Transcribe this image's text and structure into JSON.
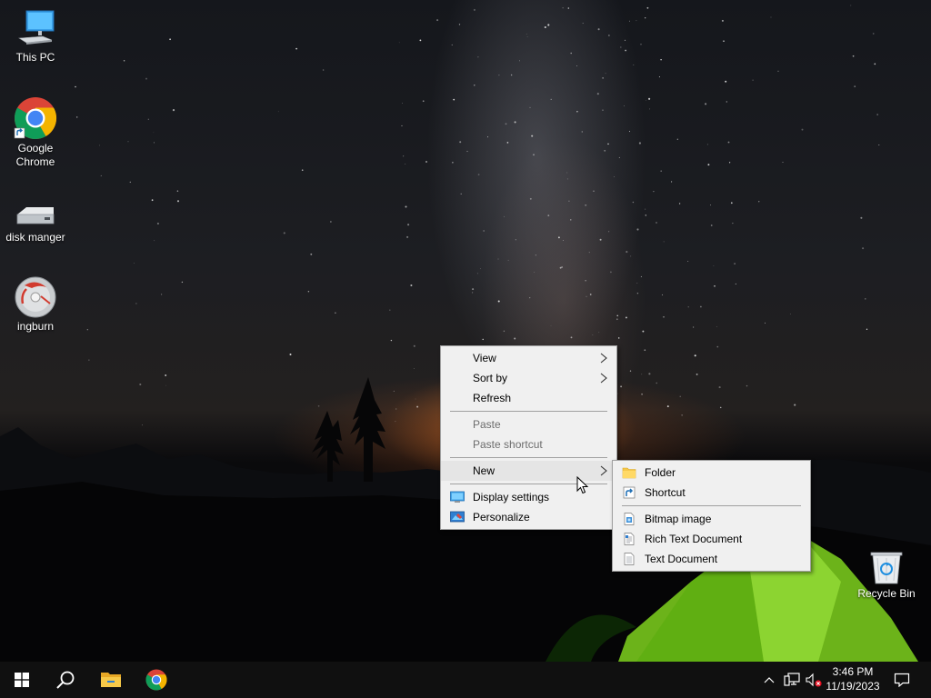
{
  "desktop": {
    "icons": [
      {
        "label": "This PC",
        "icon": "computer-icon"
      },
      {
        "label": "Google Chrome",
        "icon": "chrome-icon"
      },
      {
        "label": "disk manger",
        "icon": "drive-icon"
      },
      {
        "label": "ingburn",
        "icon": "disc-icon"
      },
      {
        "label": "Recycle Bin",
        "icon": "recycle-bin-icon"
      }
    ]
  },
  "context_menu": {
    "items": [
      {
        "label": "View",
        "submenu": true
      },
      {
        "label": "Sort by",
        "submenu": true
      },
      {
        "label": "Refresh"
      },
      {
        "label": "Paste",
        "disabled": true
      },
      {
        "label": "Paste shortcut",
        "disabled": true
      },
      {
        "label": "New",
        "submenu": true,
        "highlighted": true
      },
      {
        "label": "Display settings",
        "icon": "display-settings-icon"
      },
      {
        "label": "Personalize",
        "icon": "personalize-icon"
      }
    ]
  },
  "new_submenu": {
    "items": [
      {
        "label": "Folder",
        "icon": "folder-icon"
      },
      {
        "label": "Shortcut",
        "icon": "shortcut-icon"
      },
      {
        "label": "Bitmap image",
        "icon": "bitmap-icon"
      },
      {
        "label": "Rich Text Document",
        "icon": "rtf-document-icon"
      },
      {
        "label": "Text Document",
        "icon": "text-document-icon"
      }
    ]
  },
  "taskbar": {
    "buttons": [
      "start-icon",
      "search-icon",
      "file-explorer-icon",
      "chrome-icon"
    ],
    "tray_icons": [
      "show-hidden-icons-chevron-icon",
      "network-icon",
      "volume-muted-icon",
      "notification-center-icon"
    ],
    "clock": {
      "time": "3:46 PM",
      "date": "11/19/2023"
    }
  },
  "colors": {
    "menu_bg": "#f0f0f0",
    "menu_hover": "#e5e5e5",
    "disabled_text": "#6d6d6d",
    "taskbar_bg": "#101010",
    "tent_green": "#7fd21e"
  }
}
